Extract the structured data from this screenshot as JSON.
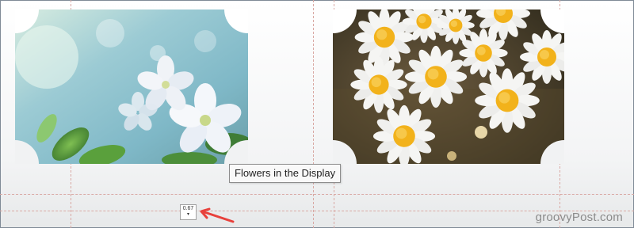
{
  "tooltip": {
    "text": "Flowers in the Display"
  },
  "spacing_control": {
    "value": "0.67",
    "caret": "▾"
  },
  "watermark": {
    "text": "groovyPost.com"
  },
  "images": [
    {
      "subject": "white apple blossoms on blue-green bokeh background"
    },
    {
      "subject": "white daisies with yellow centers"
    }
  ],
  "colors": {
    "guide": "#d9a9a4",
    "arrow": "#e8413c",
    "frame": "#7f8a96"
  }
}
